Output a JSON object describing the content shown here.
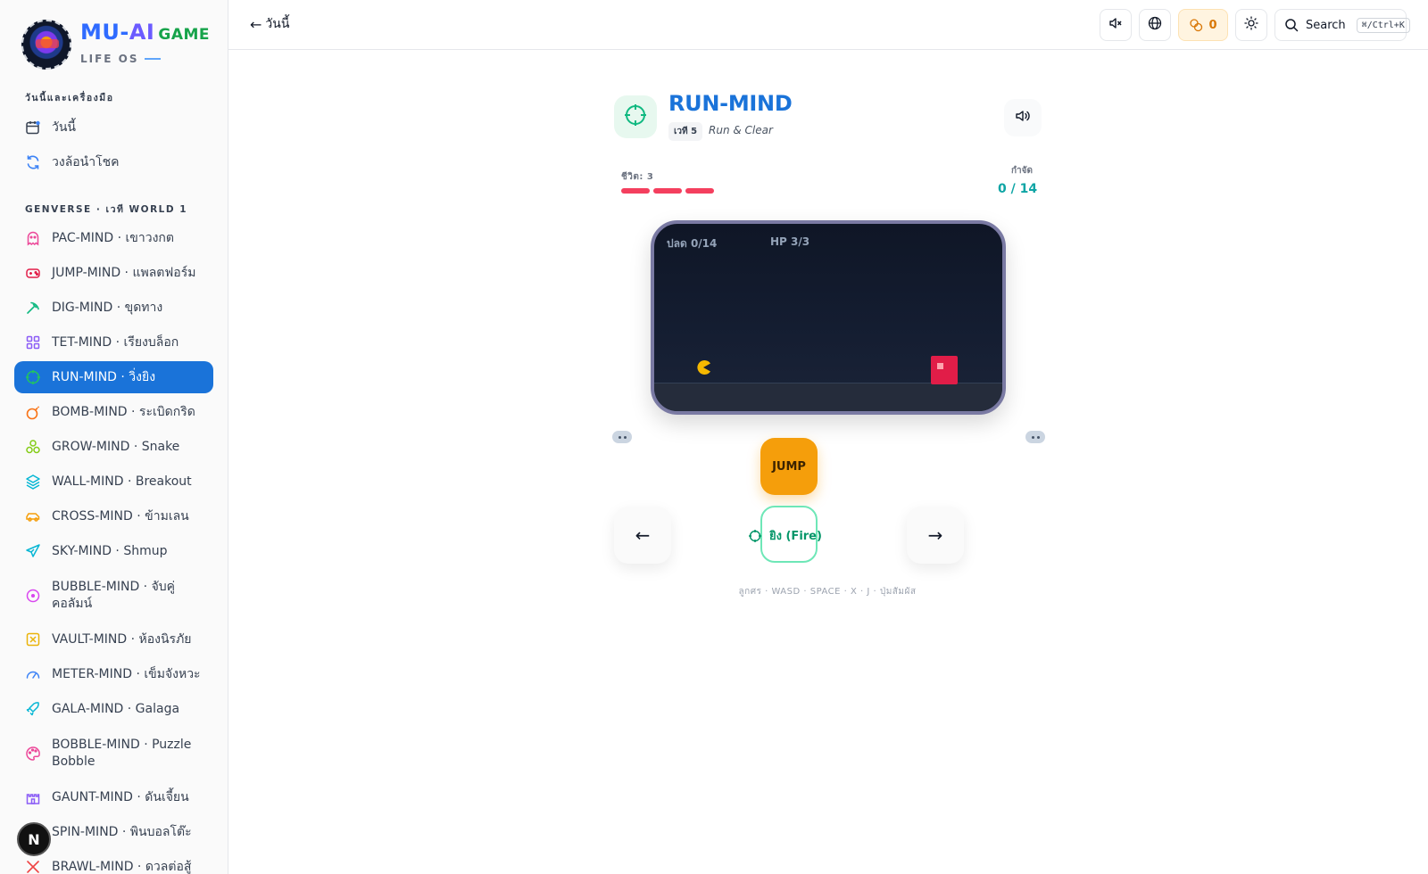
{
  "brand": {
    "mu": "MU-",
    "ai": "AI",
    "game": "GAME",
    "subtitle": "LIFE OS"
  },
  "sidebar": {
    "section_today": "วันนี้และเครื่องมือ",
    "today_items": [
      {
        "label": "วันนี้",
        "icon": "calendar-icon"
      },
      {
        "label": "วงล้อนำโชค",
        "icon": "refresh-icon"
      }
    ],
    "section_genverse": "GENVERSE · เวที WORLD 1",
    "games": [
      {
        "label": "PAC-MIND · เขาวงกต",
        "icon": "ghost-icon",
        "color": "#ec4899"
      },
      {
        "label": "JUMP-MIND · แพลตฟอร์ม",
        "icon": "gamepad-icon",
        "color": "#e11d48"
      },
      {
        "label": "DIG-MIND · ขุดทาง",
        "icon": "pickaxe-icon",
        "color": "#10b981"
      },
      {
        "label": "TET-MIND · เรียงบล็อก",
        "icon": "grid-icon",
        "color": "#8b5cf6"
      },
      {
        "label": "RUN-MIND · วิ่งยิง",
        "icon": "crosshair-icon",
        "color": "#22c55e",
        "active": true
      },
      {
        "label": "BOMB-MIND · ระเบิดกริด",
        "icon": "bomb-icon",
        "color": "#f97316"
      },
      {
        "label": "GROW-MIND · Snake",
        "icon": "shapes-icon",
        "color": "#84cc16"
      },
      {
        "label": "WALL-MIND · Breakout",
        "icon": "layers-icon",
        "color": "#06b6d4"
      },
      {
        "label": "CROSS-MIND · ข้ามเลน",
        "icon": "car-icon",
        "color": "#f59e0b"
      },
      {
        "label": "SKY-MIND · Shmup",
        "icon": "plane-icon",
        "color": "#06b6d4"
      },
      {
        "label": "BUBBLE-MIND · จับคู่คอลัมน์",
        "icon": "circle-dot-icon",
        "color": "#d946ef"
      },
      {
        "label": "VAULT-MIND · ห้องนิรภัย",
        "icon": "vault-icon",
        "color": "#eab308"
      },
      {
        "label": "METER-MIND · เข็มจังหวะ",
        "icon": "gauge-icon",
        "color": "#3b82f6"
      },
      {
        "label": "GALA-MIND · Galaga",
        "icon": "rocket-icon",
        "color": "#06b6d4"
      },
      {
        "label": "BOBBLE-MIND · Puzzle Bobble",
        "icon": "palette-icon",
        "color": "#ec4899"
      },
      {
        "label": "GAUNT-MIND · ดันเจี้ยน",
        "icon": "castle-icon",
        "color": "#8b5cf6"
      },
      {
        "label": "SPIN-MIND · พินบอลโต๊ะ",
        "icon": "pinball-icon",
        "color": "#14b8a6"
      },
      {
        "label": "BRAWL-MIND · ดวลต่อสู้",
        "icon": "swords-icon",
        "color": "#ef4444"
      }
    ]
  },
  "header": {
    "back_label": "วันนี้",
    "coins": "0",
    "search_label": "Search",
    "search_shortcut": "⌘/Ctrl+K"
  },
  "game": {
    "title": "RUN-MIND",
    "wave": "เวที 5",
    "subtitle": "Run & Clear",
    "lives_label": "ชีวิต: 3",
    "lives": 3,
    "goal_label": "กำจัด",
    "goal_value": "0 / 14",
    "hud_fish": "ปลด 0/14",
    "hud_hp": "HP 3/3",
    "jump_label": "JUMP",
    "left_label": "←",
    "right_label": "→",
    "fire_label": "ยิง (Fire)",
    "hint": "ลูกศร · WASD · SPACE · X · J · ปุ่มสัมผัส"
  },
  "badge": {
    "letter": "N"
  },
  "colors": {
    "accent": "#1a73d9",
    "life": "#f43f5e",
    "jump": "#f59e0b",
    "fire": "#059669"
  }
}
